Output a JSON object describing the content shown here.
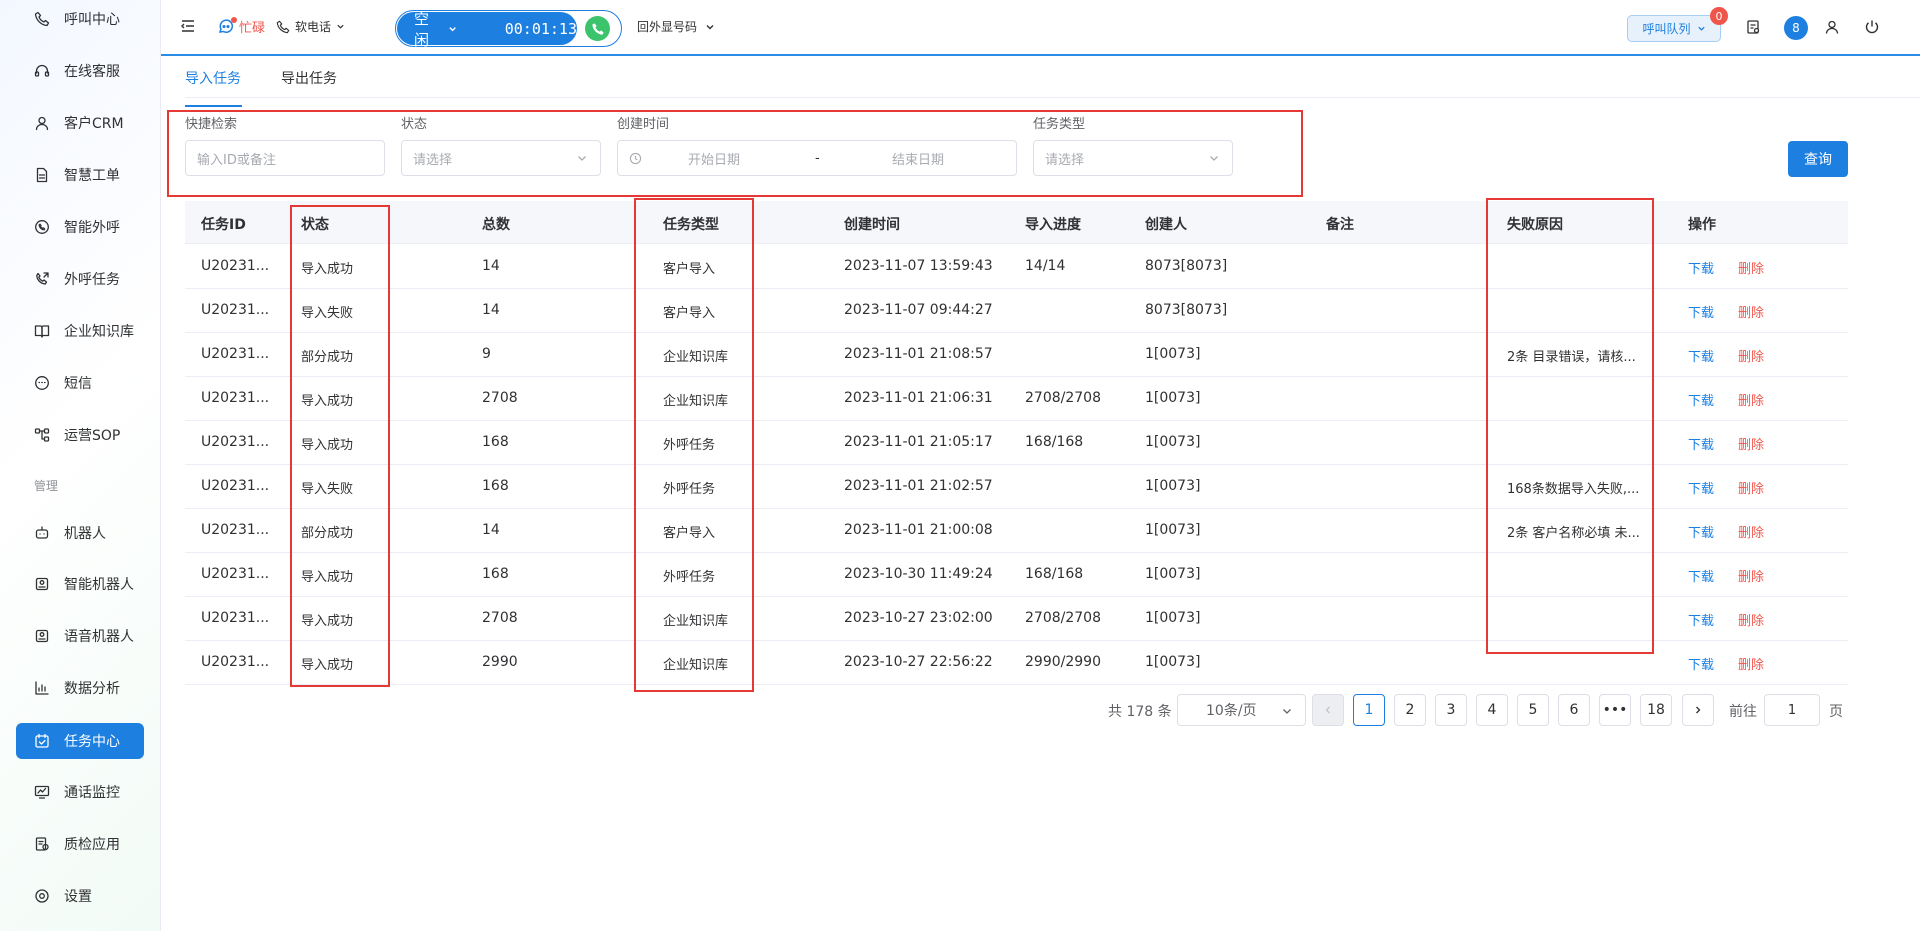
{
  "sidebar": {
    "items": [
      {
        "label": "呼叫中心",
        "icon": "phone-icon",
        "name": "sidebar-item-call-center"
      },
      {
        "label": "在线客服",
        "icon": "headset-icon",
        "name": "sidebar-item-online-service"
      },
      {
        "label": "客户CRM",
        "icon": "user-icon",
        "name": "sidebar-item-crm"
      },
      {
        "label": "智慧工单",
        "icon": "document-icon",
        "name": "sidebar-item-work-order"
      },
      {
        "label": "智能外呼",
        "icon": "whatsapp-phone-icon",
        "name": "sidebar-item-smart-outbound"
      },
      {
        "label": "外呼任务",
        "icon": "phone-outgoing-icon",
        "name": "sidebar-item-outbound-task"
      },
      {
        "label": "企业知识库",
        "icon": "book-icon",
        "name": "sidebar-item-knowledge-base"
      },
      {
        "label": "短信",
        "icon": "sms-icon",
        "name": "sidebar-item-sms"
      },
      {
        "label": "运营SOP",
        "icon": "flow-icon",
        "name": "sidebar-item-sop"
      }
    ],
    "group_label": "管理",
    "manage_items": [
      {
        "label": "机器人",
        "icon": "robot-icon",
        "name": "sidebar-item-robot"
      },
      {
        "label": "智能机器人",
        "icon": "smart-robot-icon",
        "name": "sidebar-item-smart-robot"
      },
      {
        "label": "语音机器人",
        "icon": "voice-robot-icon",
        "name": "sidebar-item-voice-robot"
      },
      {
        "label": "数据分析",
        "icon": "bar-chart-icon",
        "name": "sidebar-item-data-analysis"
      },
      {
        "label": "任务中心",
        "icon": "calendar-check-icon",
        "name": "sidebar-item-task-center",
        "active": true
      },
      {
        "label": "通话监控",
        "icon": "monitor-icon",
        "name": "sidebar-item-call-monitor"
      },
      {
        "label": "质检应用",
        "icon": "quality-check-icon",
        "name": "sidebar-item-quality-check"
      },
      {
        "label": "设置",
        "icon": "gear-icon",
        "name": "sidebar-item-settings"
      }
    ]
  },
  "header": {
    "busy_label": "忙碌",
    "softphone_label": "软电话",
    "agent_state": "空闲",
    "call_timer": "00:01:13",
    "outbound_number_label": "回外显号码",
    "queue_label": "呼叫队列",
    "queue_badge": "0",
    "user_number": "8"
  },
  "tabs": [
    {
      "label": "导入任务",
      "active": true
    },
    {
      "label": "导出任务",
      "active": false
    }
  ],
  "filters": {
    "quick_search_label": "快捷检索",
    "quick_search_placeholder": "输入ID或备注",
    "status_label": "状态",
    "status_placeholder": "请选择",
    "created_time_label": "创建时间",
    "start_date_placeholder": "开始日期",
    "date_separator": "-",
    "end_date_placeholder": "结束日期",
    "task_type_label": "任务类型",
    "task_type_placeholder": "请选择",
    "query_button": "查询"
  },
  "table": {
    "columns": [
      "任务ID",
      "状态",
      "总数",
      "任务类型",
      "创建时间",
      "导入进度",
      "创建人",
      "备注",
      "失败原因",
      "操作"
    ],
    "download_label": "下载",
    "delete_label": "删除",
    "rows": [
      {
        "id": "U20231...",
        "status": "导入成功",
        "total": "14",
        "type": "客户导入",
        "created": "2023-11-07 13:59:43",
        "progress": "14/14",
        "creator": "8073[8073]",
        "remark": "",
        "reason": ""
      },
      {
        "id": "U20231...",
        "status": "导入失败",
        "total": "14",
        "type": "客户导入",
        "created": "2023-11-07 09:44:27",
        "progress": "",
        "creator": "8073[8073]",
        "remark": "",
        "reason": ""
      },
      {
        "id": "U20231...",
        "status": "部分成功",
        "total": "9",
        "type": "企业知识库",
        "created": "2023-11-01 21:08:57",
        "progress": "",
        "creator": "1[0073]",
        "remark": "",
        "reason": "2条 目录错误，请核..."
      },
      {
        "id": "U20231...",
        "status": "导入成功",
        "total": "2708",
        "type": "企业知识库",
        "created": "2023-11-01 21:06:31",
        "progress": "2708/2708",
        "creator": "1[0073]",
        "remark": "",
        "reason": ""
      },
      {
        "id": "U20231...",
        "status": "导入成功",
        "total": "168",
        "type": "外呼任务",
        "created": "2023-11-01 21:05:17",
        "progress": "168/168",
        "creator": "1[0073]",
        "remark": "",
        "reason": ""
      },
      {
        "id": "U20231...",
        "status": "导入失败",
        "total": "168",
        "type": "外呼任务",
        "created": "2023-11-01 21:02:57",
        "progress": "",
        "creator": "1[0073]",
        "remark": "",
        "reason": "168条数据导入失败,..."
      },
      {
        "id": "U20231...",
        "status": "部分成功",
        "total": "14",
        "type": "客户导入",
        "created": "2023-11-01 21:00:08",
        "progress": "",
        "creator": "1[0073]",
        "remark": "",
        "reason": "2条 客户名称必填 未..."
      },
      {
        "id": "U20231...",
        "status": "导入成功",
        "total": "168",
        "type": "外呼任务",
        "created": "2023-10-30 11:49:24",
        "progress": "168/168",
        "creator": "1[0073]",
        "remark": "",
        "reason": ""
      },
      {
        "id": "U20231...",
        "status": "导入成功",
        "total": "2708",
        "type": "企业知识库",
        "created": "2023-10-27 23:02:00",
        "progress": "2708/2708",
        "creator": "1[0073]",
        "remark": "",
        "reason": ""
      },
      {
        "id": "U20231...",
        "status": "导入成功",
        "total": "2990",
        "type": "企业知识库",
        "created": "2023-10-27 22:56:22",
        "progress": "2990/2990",
        "creator": "1[0073]",
        "remark": "",
        "reason": ""
      }
    ]
  },
  "pagination": {
    "total_text": "共 178 条",
    "page_size": "10条/页",
    "pages": [
      "1",
      "2",
      "3",
      "4",
      "5",
      "6",
      "•••",
      "18"
    ],
    "current_page": "1",
    "goto_label": "前往",
    "goto_value": "1",
    "page_unit": "页"
  },
  "colors": {
    "primary": "#1d7fe0",
    "danger": "#f0554a",
    "highlight_box": "#e53935",
    "call_green": "#3bc46b"
  }
}
